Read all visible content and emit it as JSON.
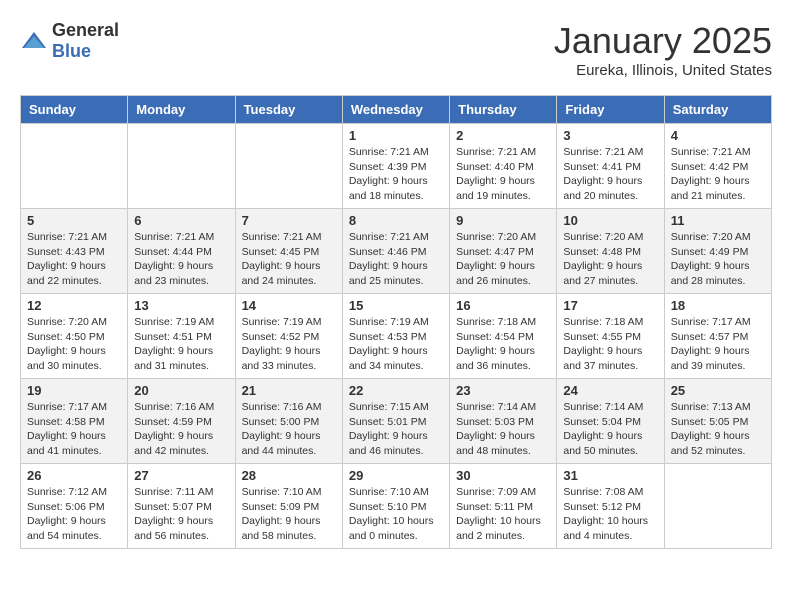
{
  "header": {
    "logo_general": "General",
    "logo_blue": "Blue",
    "title": "January 2025",
    "subtitle": "Eureka, Illinois, United States"
  },
  "weekdays": [
    "Sunday",
    "Monday",
    "Tuesday",
    "Wednesday",
    "Thursday",
    "Friday",
    "Saturday"
  ],
  "weeks": [
    [
      {
        "day": "",
        "details": ""
      },
      {
        "day": "",
        "details": ""
      },
      {
        "day": "",
        "details": ""
      },
      {
        "day": "1",
        "details": "Sunrise: 7:21 AM\nSunset: 4:39 PM\nDaylight: 9 hours\nand 18 minutes."
      },
      {
        "day": "2",
        "details": "Sunrise: 7:21 AM\nSunset: 4:40 PM\nDaylight: 9 hours\nand 19 minutes."
      },
      {
        "day": "3",
        "details": "Sunrise: 7:21 AM\nSunset: 4:41 PM\nDaylight: 9 hours\nand 20 minutes."
      },
      {
        "day": "4",
        "details": "Sunrise: 7:21 AM\nSunset: 4:42 PM\nDaylight: 9 hours\nand 21 minutes."
      }
    ],
    [
      {
        "day": "5",
        "details": "Sunrise: 7:21 AM\nSunset: 4:43 PM\nDaylight: 9 hours\nand 22 minutes."
      },
      {
        "day": "6",
        "details": "Sunrise: 7:21 AM\nSunset: 4:44 PM\nDaylight: 9 hours\nand 23 minutes."
      },
      {
        "day": "7",
        "details": "Sunrise: 7:21 AM\nSunset: 4:45 PM\nDaylight: 9 hours\nand 24 minutes."
      },
      {
        "day": "8",
        "details": "Sunrise: 7:21 AM\nSunset: 4:46 PM\nDaylight: 9 hours\nand 25 minutes."
      },
      {
        "day": "9",
        "details": "Sunrise: 7:20 AM\nSunset: 4:47 PM\nDaylight: 9 hours\nand 26 minutes."
      },
      {
        "day": "10",
        "details": "Sunrise: 7:20 AM\nSunset: 4:48 PM\nDaylight: 9 hours\nand 27 minutes."
      },
      {
        "day": "11",
        "details": "Sunrise: 7:20 AM\nSunset: 4:49 PM\nDaylight: 9 hours\nand 28 minutes."
      }
    ],
    [
      {
        "day": "12",
        "details": "Sunrise: 7:20 AM\nSunset: 4:50 PM\nDaylight: 9 hours\nand 30 minutes."
      },
      {
        "day": "13",
        "details": "Sunrise: 7:19 AM\nSunset: 4:51 PM\nDaylight: 9 hours\nand 31 minutes."
      },
      {
        "day": "14",
        "details": "Sunrise: 7:19 AM\nSunset: 4:52 PM\nDaylight: 9 hours\nand 33 minutes."
      },
      {
        "day": "15",
        "details": "Sunrise: 7:19 AM\nSunset: 4:53 PM\nDaylight: 9 hours\nand 34 minutes."
      },
      {
        "day": "16",
        "details": "Sunrise: 7:18 AM\nSunset: 4:54 PM\nDaylight: 9 hours\nand 36 minutes."
      },
      {
        "day": "17",
        "details": "Sunrise: 7:18 AM\nSunset: 4:55 PM\nDaylight: 9 hours\nand 37 minutes."
      },
      {
        "day": "18",
        "details": "Sunrise: 7:17 AM\nSunset: 4:57 PM\nDaylight: 9 hours\nand 39 minutes."
      }
    ],
    [
      {
        "day": "19",
        "details": "Sunrise: 7:17 AM\nSunset: 4:58 PM\nDaylight: 9 hours\nand 41 minutes."
      },
      {
        "day": "20",
        "details": "Sunrise: 7:16 AM\nSunset: 4:59 PM\nDaylight: 9 hours\nand 42 minutes."
      },
      {
        "day": "21",
        "details": "Sunrise: 7:16 AM\nSunset: 5:00 PM\nDaylight: 9 hours\nand 44 minutes."
      },
      {
        "day": "22",
        "details": "Sunrise: 7:15 AM\nSunset: 5:01 PM\nDaylight: 9 hours\nand 46 minutes."
      },
      {
        "day": "23",
        "details": "Sunrise: 7:14 AM\nSunset: 5:03 PM\nDaylight: 9 hours\nand 48 minutes."
      },
      {
        "day": "24",
        "details": "Sunrise: 7:14 AM\nSunset: 5:04 PM\nDaylight: 9 hours\nand 50 minutes."
      },
      {
        "day": "25",
        "details": "Sunrise: 7:13 AM\nSunset: 5:05 PM\nDaylight: 9 hours\nand 52 minutes."
      }
    ],
    [
      {
        "day": "26",
        "details": "Sunrise: 7:12 AM\nSunset: 5:06 PM\nDaylight: 9 hours\nand 54 minutes."
      },
      {
        "day": "27",
        "details": "Sunrise: 7:11 AM\nSunset: 5:07 PM\nDaylight: 9 hours\nand 56 minutes."
      },
      {
        "day": "28",
        "details": "Sunrise: 7:10 AM\nSunset: 5:09 PM\nDaylight: 9 hours\nand 58 minutes."
      },
      {
        "day": "29",
        "details": "Sunrise: 7:10 AM\nSunset: 5:10 PM\nDaylight: 10 hours\nand 0 minutes."
      },
      {
        "day": "30",
        "details": "Sunrise: 7:09 AM\nSunset: 5:11 PM\nDaylight: 10 hours\nand 2 minutes."
      },
      {
        "day": "31",
        "details": "Sunrise: 7:08 AM\nSunset: 5:12 PM\nDaylight: 10 hours\nand 4 minutes."
      },
      {
        "day": "",
        "details": ""
      }
    ]
  ]
}
